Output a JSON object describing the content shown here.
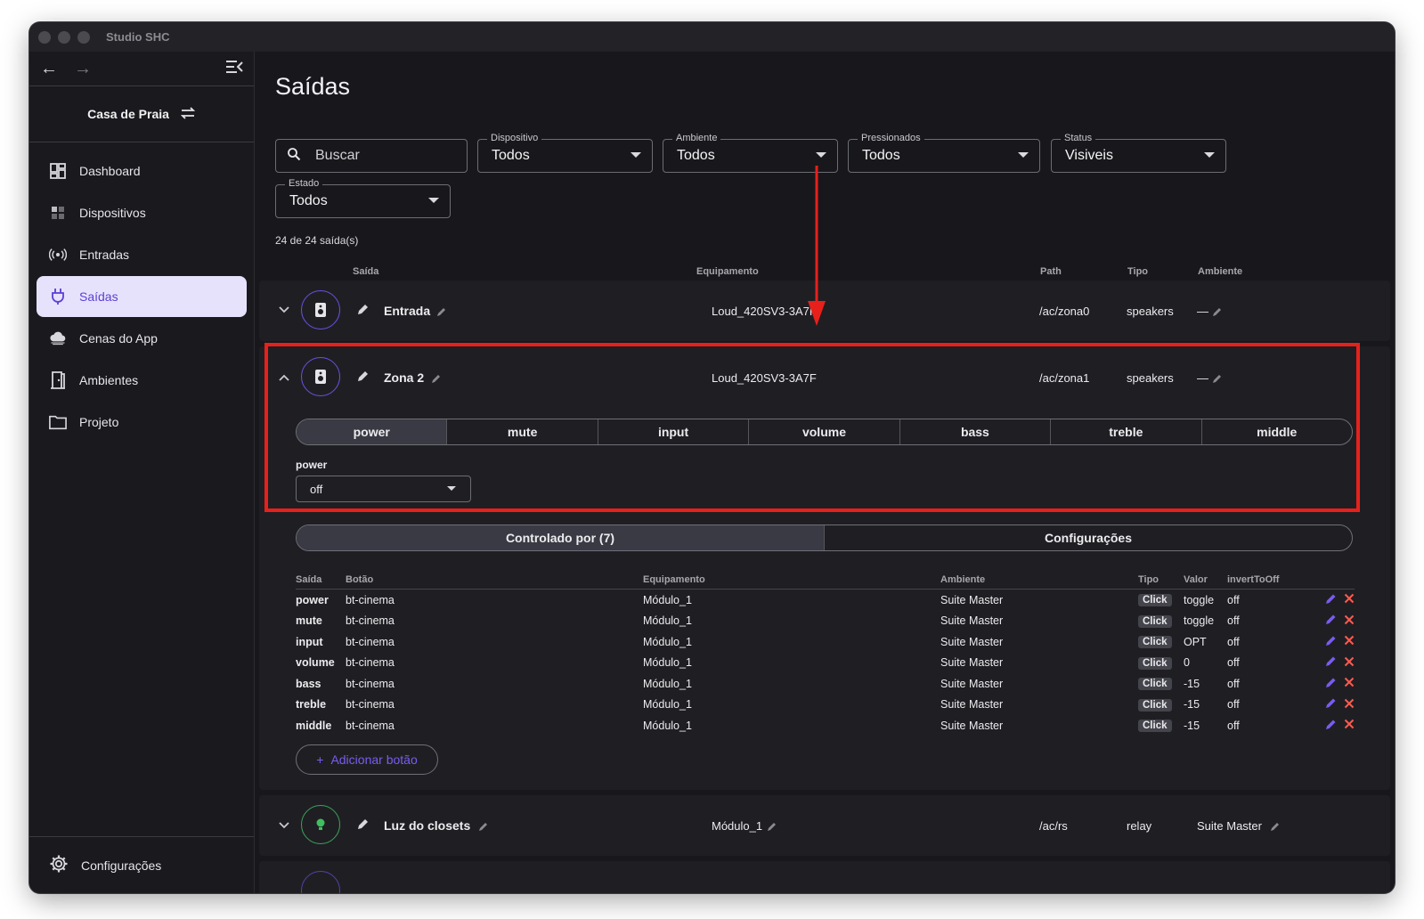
{
  "window": {
    "title": "Studio SHC"
  },
  "sidebar": {
    "project": "Casa de Praia",
    "items": [
      {
        "label": "Dashboard",
        "icon": "dashboard-icon"
      },
      {
        "label": "Dispositivos",
        "icon": "devices-icon"
      },
      {
        "label": "Entradas",
        "icon": "broadcast-icon"
      },
      {
        "label": "Saídas",
        "icon": "plug-icon",
        "active": true
      },
      {
        "label": "Cenas do App",
        "icon": "cloud-icon"
      },
      {
        "label": "Ambientes",
        "icon": "door-icon"
      },
      {
        "label": "Projeto",
        "icon": "folder-icon"
      }
    ],
    "footer": "Configurações"
  },
  "main": {
    "title": "Saídas",
    "search": {
      "placeholder": "Buscar"
    },
    "filters": [
      {
        "label": "Dispositivo",
        "value": "Todos"
      },
      {
        "label": "Ambiente",
        "value": "Todos"
      },
      {
        "label": "Pressionados",
        "value": "Todos"
      },
      {
        "label": "Status",
        "value": "Visiveis"
      },
      {
        "label": "Estado",
        "value": "Todos"
      }
    ],
    "count": "24 de 24 saída(s)",
    "columns": {
      "saida": "Saída",
      "equipamento": "Equipamento",
      "path": "Path",
      "tipo": "Tipo",
      "ambiente": "Ambiente"
    },
    "rows": [
      {
        "name": "Entrada",
        "equipamento": "Loud_420SV3-3A7F",
        "path": "/ac/zona0",
        "tipo": "speakers",
        "ambiente": "—"
      },
      {
        "name": "Zona 2",
        "equipamento": "Loud_420SV3-3A7F",
        "path": "/ac/zona1",
        "tipo": "speakers",
        "ambiente": "—"
      },
      {
        "name": "Luz do closets",
        "equipamento": "Módulo_1",
        "path": "/ac/rs",
        "tipo": "relay",
        "ambiente": "Suite Master"
      }
    ],
    "expanded": {
      "commands": [
        "power",
        "mute",
        "input",
        "volume",
        "bass",
        "treble",
        "middle"
      ],
      "selected_label": "power",
      "selected_value": "off",
      "tabs": [
        "Controlado por (7)",
        "Configurações"
      ],
      "table_headers": [
        "Saída",
        "Botão",
        "Equipamento",
        "Ambiente",
        "Tipo",
        "Valor",
        "invertToOff"
      ],
      "table_rows": [
        {
          "saida": "power",
          "botao": "bt-cinema",
          "equip": "Módulo_1",
          "ambiente": "Suite Master",
          "tipo": "Click",
          "valor": "toggle",
          "invert": "off"
        },
        {
          "saida": "mute",
          "botao": "bt-cinema",
          "equip": "Módulo_1",
          "ambiente": "Suite Master",
          "tipo": "Click",
          "valor": "toggle",
          "invert": "off"
        },
        {
          "saida": "input",
          "botao": "bt-cinema",
          "equip": "Módulo_1",
          "ambiente": "Suite Master",
          "tipo": "Click",
          "valor": "OPT",
          "invert": "off"
        },
        {
          "saida": "volume",
          "botao": "bt-cinema",
          "equip": "Módulo_1",
          "ambiente": "Suite Master",
          "tipo": "Click",
          "valor": "0",
          "invert": "off"
        },
        {
          "saida": "bass",
          "botao": "bt-cinema",
          "equip": "Módulo_1",
          "ambiente": "Suite Master",
          "tipo": "Click",
          "valor": "-15",
          "invert": "off"
        },
        {
          "saida": "treble",
          "botao": "bt-cinema",
          "equip": "Módulo_1",
          "ambiente": "Suite Master",
          "tipo": "Click",
          "valor": "-15",
          "invert": "off"
        },
        {
          "saida": "middle",
          "botao": "bt-cinema",
          "equip": "Módulo_1",
          "ambiente": "Suite Master",
          "tipo": "Click",
          "valor": "-15",
          "invert": "off"
        }
      ],
      "add_button": "Adicionar botão"
    }
  },
  "colors": {
    "accent": "#6d4fe2",
    "highlight": "#e8201b",
    "active_nav_bg": "#e7e2fb"
  }
}
